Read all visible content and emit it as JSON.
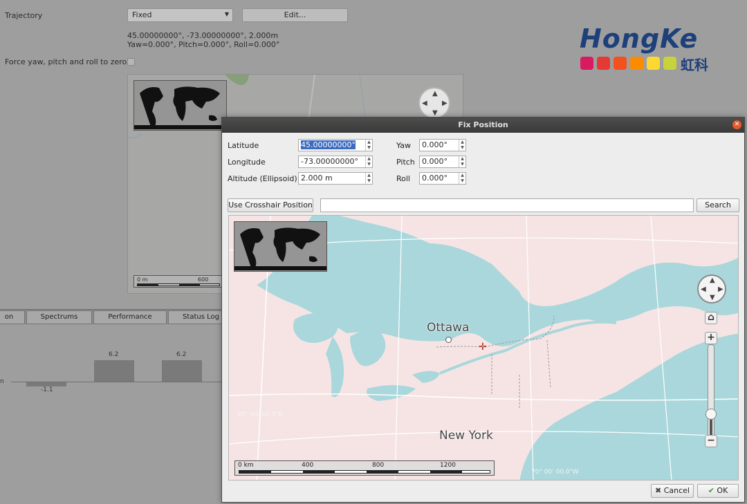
{
  "background": {
    "trajectory_label": "Trajectory",
    "trajectory_value": "Fixed",
    "edit_button": "Edit...",
    "position_line1": "45.00000000°, -73.00000000°, 2.000m",
    "position_line2": "Yaw=0.000°, Pitch=0.000°, Roll=0.000°",
    "force_zero_label": "Force yaw, pitch and roll to zero",
    "scale": {
      "ticks": [
        "0 m",
        "600"
      ]
    },
    "tabs": [
      "on",
      "Spectrums",
      "Performance",
      "Status Log"
    ],
    "bar_axis_label": "n",
    "bars": [
      {
        "label": "-1.1",
        "value": -1.1
      },
      {
        "label": "6.2",
        "value": 6.2
      },
      {
        "label": "6.2",
        "value": 6.2
      }
    ]
  },
  "logo": {
    "text": "HongKe",
    "cn": "虹科",
    "dot_colors": [
      "#d81b60",
      "#e53935",
      "#f4511e",
      "#fb8c00",
      "#fdd835",
      "#c6d33a"
    ]
  },
  "dialog": {
    "title": "Fix Position",
    "close_glyph": "✕",
    "fields": {
      "latitude": {
        "label": "Latitude",
        "value": "45.00000000°"
      },
      "longitude": {
        "label": "Longitude",
        "value": "-73.00000000°"
      },
      "altitude": {
        "label": "Altitude (Ellipsoid)",
        "value": "2.000 m"
      },
      "yaw": {
        "label": "Yaw",
        "value": "0.000°"
      },
      "pitch": {
        "label": "Pitch",
        "value": "0.000°"
      },
      "roll": {
        "label": "Roll",
        "value": "0.000°"
      }
    },
    "use_crosshair_button": "Use Crosshair Position",
    "search_placeholder": "",
    "search_button": "Search",
    "map": {
      "cities": [
        "Ottawa",
        "New York"
      ],
      "coord_labels": [
        "45° 00' 00.0\"N",
        "70° 00' 00.0\"W"
      ],
      "crosshair_glyph": "✛",
      "scale_ticks": [
        "0 km",
        "400",
        "800",
        "1200"
      ],
      "zoom_in": "+",
      "zoom_out": "−",
      "home_glyph": "⌂",
      "zoom_level": 0.32
    },
    "cancel_button": "Cancel",
    "ok_button": "OK",
    "cancel_icon": "✖",
    "ok_icon": "✔"
  },
  "colors": {
    "land": "#f5e3e3",
    "water": "#a9d7db",
    "highlight": "#3a6bc0",
    "titlebar": "#404040"
  }
}
